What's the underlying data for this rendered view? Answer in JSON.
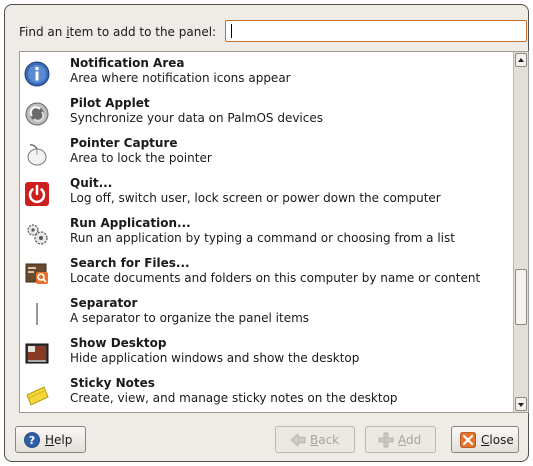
{
  "dialog": {
    "search_label_pre": "Find an ",
    "search_label_mn": "i",
    "search_label_post": "tem to add to the panel:",
    "search_value": ""
  },
  "items": [
    {
      "name": "Notification Area",
      "desc": "Area where notification icons appear",
      "icon": "info-icon"
    },
    {
      "name": "Pilot Applet",
      "desc": "Synchronize your data on PalmOS devices",
      "icon": "pilot-sync-icon"
    },
    {
      "name": "Pointer Capture",
      "desc": "Area to lock the pointer",
      "icon": "mouse-icon"
    },
    {
      "name": "Quit...",
      "desc": "Log off, switch user, lock screen or power down the computer",
      "icon": "power-icon"
    },
    {
      "name": "Run Application...",
      "desc": "Run an application by typing a command or choosing from a list",
      "icon": "gears-icon"
    },
    {
      "name": "Search for Files...",
      "desc": "Locate documents and folders on this computer by name or content",
      "icon": "search-files-icon"
    },
    {
      "name": "Separator",
      "desc": "A separator to organize the panel items",
      "icon": "separator-icon"
    },
    {
      "name": "Show Desktop",
      "desc": "Hide application windows and show the desktop",
      "icon": "desktop-icon"
    },
    {
      "name": "Sticky Notes",
      "desc": "Create, view, and manage sticky notes on the desktop",
      "icon": "sticky-notes-icon"
    }
  ],
  "buttons": {
    "help_mn": "H",
    "help_rest": "elp",
    "back_mn": "B",
    "back_rest": "ack",
    "add_mn": "A",
    "add_rest": "dd",
    "close_mn": "C",
    "close_rest": "lose"
  },
  "colors": {
    "accent": "#c8702a",
    "quit_red": "#cc1f1f",
    "info_blue": "#2e5fa8",
    "close_orange": "#e8722a"
  }
}
